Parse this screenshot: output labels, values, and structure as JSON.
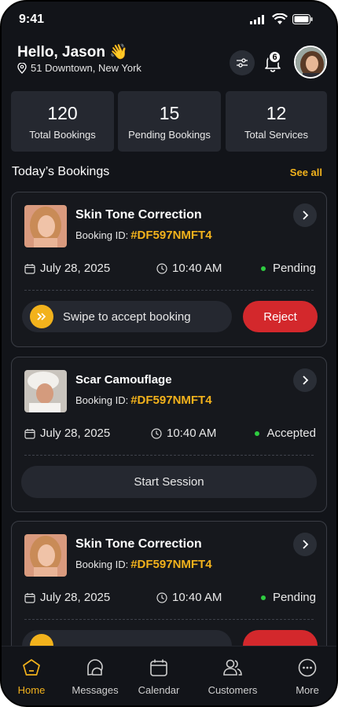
{
  "status_bar": {
    "time": "9:41"
  },
  "header": {
    "greeting": "Hello, Jason 👋",
    "location": "51 Downtown, New York",
    "notification_count": "6"
  },
  "stats": [
    {
      "value": "120",
      "label": "Total Bookings"
    },
    {
      "value": "15",
      "label": "Pending Bookings"
    },
    {
      "value": "12",
      "label": "Total Services"
    }
  ],
  "section": {
    "title": "Today’s Bookings",
    "see_all": "See all"
  },
  "bookings": [
    {
      "service": "Skin Tone Correction",
      "booking_id_label": "Booking ID:",
      "booking_id": "#DF597NMFT4",
      "date": "July 28, 2025",
      "time": "10:40 AM",
      "status": "Pending",
      "swipe_label": "Swipe to accept booking",
      "reject_label": "Reject"
    },
    {
      "service": "Scar Camouflage",
      "booking_id_label": "Booking ID:",
      "booking_id": "#DF597NMFT4",
      "date": "July 28, 2025",
      "time": "10:40 AM",
      "status": "Accepted",
      "start_label": "Start Session"
    },
    {
      "service": "Skin Tone Correction",
      "booking_id_label": "Booking ID:",
      "booking_id": "#DF597NMFT4",
      "date": "July 28, 2025",
      "time": "10:40 AM",
      "status": "Pending"
    }
  ],
  "nav": [
    {
      "label": "Home",
      "icon": "home-icon",
      "active": true
    },
    {
      "label": "Messages",
      "icon": "messages-icon"
    },
    {
      "label": "Calendar",
      "icon": "calendar-icon"
    },
    {
      "label": "Customers",
      "icon": "customers-icon"
    },
    {
      "label": "More",
      "icon": "more-icon"
    }
  ],
  "colors": {
    "background": "#121419",
    "accent": "#f2b21c",
    "reject": "#d3282c",
    "status_green": "#2ecc40"
  }
}
